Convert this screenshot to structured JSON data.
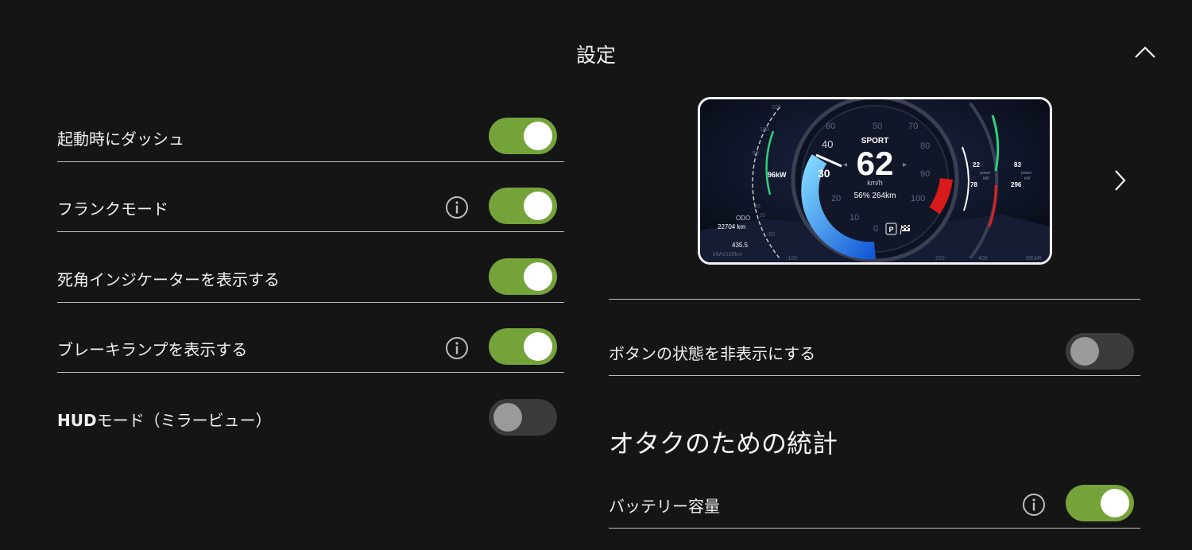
{
  "header": {
    "title": "設定"
  },
  "left_settings": [
    {
      "label": "起動時にダッシュ",
      "on": true,
      "info": false
    },
    {
      "label": "フランクモード",
      "on": true,
      "info": true
    },
    {
      "label": "死角インジケーターを表示する",
      "on": true,
      "info": false
    },
    {
      "label": "ブレーキランプを表示する",
      "on": true,
      "info": true
    },
    {
      "label_bold": "HUD",
      "label_rest": "モード（ミラービュー）",
      "on": false,
      "info": false
    }
  ],
  "right_settings": {
    "hide_button_state": {
      "label": "ボタンの状態を非表示にする",
      "on": false
    },
    "nerd_stats_title": "オタクのための統計",
    "battery_capacity": {
      "label": "バッテリー容量",
      "on": true,
      "info": true
    }
  },
  "dashboard_preview": {
    "mode": "SPORT",
    "speed": "62",
    "speed_unit": "km/h",
    "battery_range": "56% 264km",
    "left_power": "96kW",
    "odo_label": "ODO",
    "odo_value": "22704 km",
    "consumption_value": "435.5",
    "consumption_unit": "kWh/100km",
    "gear": "P",
    "front_power_top": "22",
    "front_power_bottom": "78",
    "rear_power_top": "83",
    "rear_power_bottom": "296",
    "power_label": "power",
    "power_unit": "kW",
    "rear_label": "REAR",
    "speed_scale": [
      "0",
      "10",
      "20",
      "30",
      "40",
      "50",
      "60",
      "70",
      "80",
      "90",
      "100"
    ],
    "left_scale": [
      "200",
      "100",
      "50",
      "20",
      "-20",
      "-50",
      "-100"
    ],
    "right_scale": [
      "220",
      "400"
    ]
  },
  "colors": {
    "toggle_on": "#74a33a",
    "toggle_off": "#3b3b3b",
    "background": "#151515"
  },
  "icons": [
    "chevron-up-icon",
    "info-icon",
    "chevron-right-icon",
    "checkered-flag-icon"
  ]
}
